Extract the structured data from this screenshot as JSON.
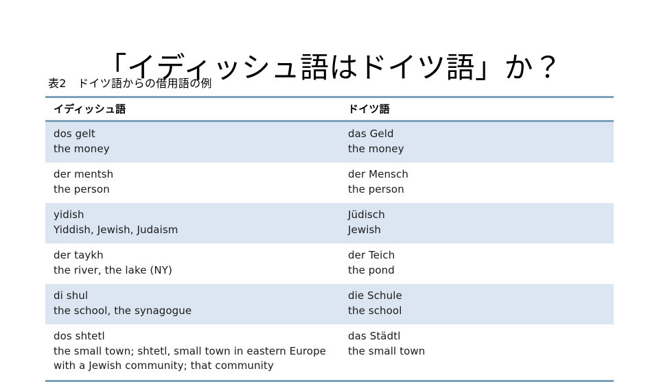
{
  "slide": {
    "title": "「イディッシュ語はドイツ語」か？",
    "caption": "表2　ドイツ語からの借用語の例",
    "accent_color": "#7ba2b8",
    "band_color": "#dce6f2",
    "background_color": "#ffffff",
    "text_color": "#1a1a1a"
  },
  "table": {
    "columns": [
      {
        "key": "yiddish",
        "header": "イディッシュ語"
      },
      {
        "key": "german",
        "header": "ドイツ語"
      }
    ],
    "rows": [
      {
        "yiddish_term": "dos gelt",
        "yiddish_gloss": "the money",
        "german_term": "das Geld",
        "german_gloss": "the money"
      },
      {
        "yiddish_term": "der mentsh",
        "yiddish_gloss": "the person",
        "german_term": "der Mensch",
        "german_gloss": "the person"
      },
      {
        "yiddish_term": "yidish",
        "yiddish_gloss": "Yiddish, Jewish, Judaism",
        "german_term": "Jüdisch",
        "german_gloss": "Jewish"
      },
      {
        "yiddish_term": "der taykh",
        "yiddish_gloss": "the river, the lake (NY)",
        "german_term": "der Teich",
        "german_gloss": "the pond"
      },
      {
        "yiddish_term": "di shul",
        "yiddish_gloss": "the school, the synagogue",
        "german_term": "die Schule",
        "german_gloss": "the school"
      },
      {
        "yiddish_term": "dos shtetl",
        "yiddish_gloss": "the small town; shtetl, small town in eastern Europe with a Jewish community; that community",
        "german_term": "das Städtl",
        "german_gloss": "the small town"
      }
    ]
  }
}
